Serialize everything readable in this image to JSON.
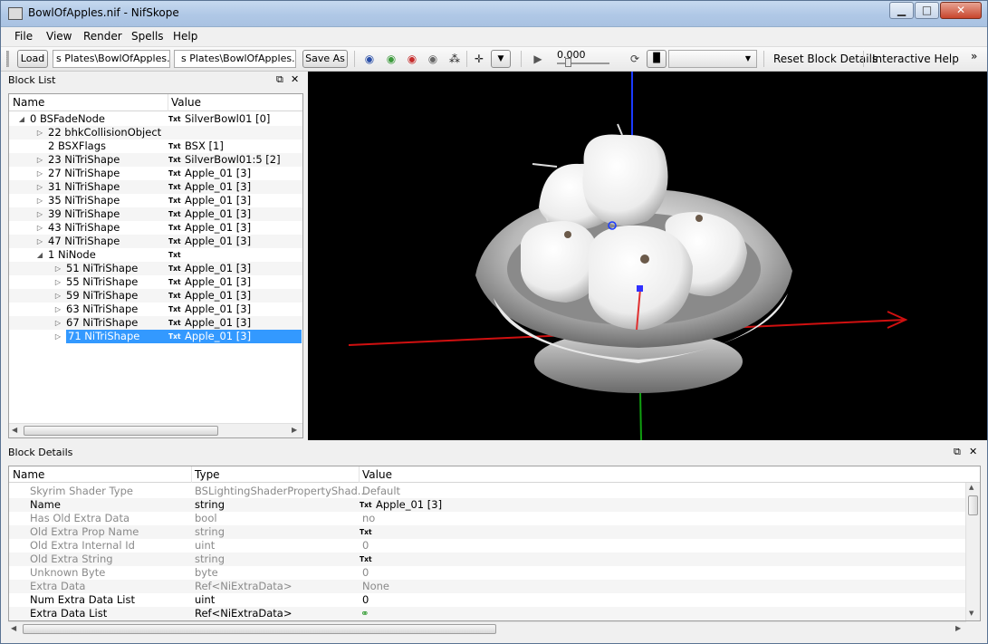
{
  "window": {
    "title": "BowlOfApples.nif - NifSkope",
    "min_label": "▁",
    "max_label": "□",
    "close_label": "✕"
  },
  "menu": [
    "File",
    "View",
    "Render",
    "Spells",
    "Help"
  ],
  "toolbar": {
    "load_label": "Load",
    "load_path": "s Plates\\BowlOfApples.nif",
    "save_path": "s Plates\\BowlOfApples.nif",
    "save_as_label": "Save As",
    "time_value": "0.000",
    "reset_label": "Reset Block Details",
    "help_label": "Interactive Help",
    "more_label": "»"
  },
  "block_list": {
    "title": "Block List",
    "col_name": "Name",
    "col_value": "Value",
    "rows": [
      {
        "name": "0 BSFadeNode",
        "value": "SilverBowl01 [0]",
        "txt": "Txt",
        "expand": "open",
        "level": 0
      },
      {
        "name": "22 bhkCollisionObject",
        "value": "",
        "txt": "",
        "expand": "closed",
        "level": 1
      },
      {
        "name": "2 BSXFlags",
        "value": "BSX [1]",
        "txt": "Txt",
        "expand": "none",
        "level": 1
      },
      {
        "name": "23 NiTriShape",
        "value": "SilverBowl01:5 [2]",
        "txt": "Txt",
        "expand": "closed",
        "level": 1
      },
      {
        "name": "27 NiTriShape",
        "value": "Apple_01 [3]",
        "txt": "Txt",
        "expand": "closed",
        "level": 1
      },
      {
        "name": "31 NiTriShape",
        "value": "Apple_01 [3]",
        "txt": "Txt",
        "expand": "closed",
        "level": 1
      },
      {
        "name": "35 NiTriShape",
        "value": "Apple_01 [3]",
        "txt": "Txt",
        "expand": "closed",
        "level": 1
      },
      {
        "name": "39 NiTriShape",
        "value": "Apple_01 [3]",
        "txt": "Txt",
        "expand": "closed",
        "level": 1
      },
      {
        "name": "43 NiTriShape",
        "value": "Apple_01 [3]",
        "txt": "Txt",
        "expand": "closed",
        "level": 1
      },
      {
        "name": "47 NiTriShape",
        "value": "Apple_01 [3]",
        "txt": "Txt",
        "expand": "closed",
        "level": 1
      },
      {
        "name": "1 NiNode",
        "value": "",
        "txt": "Txt",
        "expand": "open",
        "level": 1
      },
      {
        "name": "51 NiTriShape",
        "value": "Apple_01 [3]",
        "txt": "Txt",
        "expand": "closed",
        "level": 2
      },
      {
        "name": "55 NiTriShape",
        "value": "Apple_01 [3]",
        "txt": "Txt",
        "expand": "closed",
        "level": 2
      },
      {
        "name": "59 NiTriShape",
        "value": "Apple_01 [3]",
        "txt": "Txt",
        "expand": "closed",
        "level": 2
      },
      {
        "name": "63 NiTriShape",
        "value": "Apple_01 [3]",
        "txt": "Txt",
        "expand": "closed",
        "level": 2
      },
      {
        "name": "67 NiTriShape",
        "value": "Apple_01 [3]",
        "txt": "Txt",
        "expand": "closed",
        "level": 2
      },
      {
        "name": "71 NiTriShape",
        "value": "Apple_01 [3]",
        "txt": "Txt",
        "expand": "closed",
        "level": 2,
        "selected": true
      }
    ]
  },
  "block_details": {
    "title": "Block Details",
    "col_name": "Name",
    "col_type": "Type",
    "col_value": "Value",
    "rows": [
      {
        "name": "Skyrim Shader Type",
        "type": "BSLightingShaderPropertyShad...",
        "value": "Default",
        "txt": "",
        "dim": true
      },
      {
        "name": "Name",
        "type": "string",
        "value": "Apple_01 [3]",
        "txt": "Txt",
        "dim": false
      },
      {
        "name": "Has Old Extra Data",
        "type": "bool",
        "value": "no",
        "txt": "",
        "dim": true
      },
      {
        "name": "Old Extra Prop Name",
        "type": "string",
        "value": "",
        "txt": "Txt",
        "dim": true
      },
      {
        "name": "Old Extra Internal Id",
        "type": "uint",
        "value": "0",
        "txt": "",
        "dim": true
      },
      {
        "name": "Old Extra String",
        "type": "string",
        "value": "",
        "txt": "Txt",
        "dim": true
      },
      {
        "name": "Unknown Byte",
        "type": "byte",
        "value": "0",
        "txt": "",
        "dim": true
      },
      {
        "name": "Extra Data",
        "type": "Ref<NiExtraData>",
        "value": "None",
        "txt": "",
        "dim": true
      },
      {
        "name": "Num Extra Data List",
        "type": "uint",
        "value": "0",
        "txt": "",
        "dim": false
      },
      {
        "name": "Extra Data List",
        "type": "Ref<NiExtraData>",
        "value": "",
        "txt": "",
        "dim": false,
        "icon": "green-link-icon"
      }
    ]
  },
  "colors": {
    "selection": "#3399ff",
    "axis_x": "#d01010",
    "axis_y": "#10a010",
    "axis_z": "#1a3aff"
  }
}
